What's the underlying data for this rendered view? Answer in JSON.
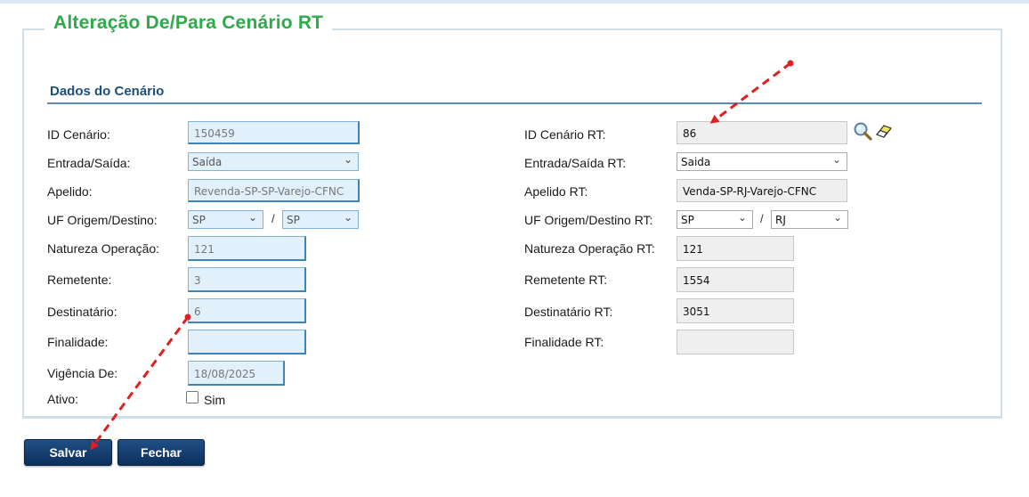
{
  "title": "Alteração De/Para Cenário RT",
  "section_title": "Dados do Cenário",
  "left": {
    "id_cenario": {
      "label": "ID Cenário:",
      "value": "150459"
    },
    "entrada_saida": {
      "label": "Entrada/Saída:",
      "value": "Saída"
    },
    "apelido": {
      "label": "Apelido:",
      "value": "Revenda-SP-SP-Varejo-CFNC"
    },
    "uf": {
      "label": "UF Origem/Destino:",
      "origem": "SP",
      "destino": "SP"
    },
    "natureza": {
      "label": "Natureza Operação:",
      "value": "121"
    },
    "remetente": {
      "label": "Remetente:",
      "value": "3"
    },
    "destinatario": {
      "label": "Destinatário:",
      "value": "6"
    },
    "finalidade": {
      "label": "Finalidade:",
      "value": ""
    },
    "vigencia": {
      "label": "Vigência De:",
      "value": "18/08/2025"
    },
    "ativo": {
      "label": "Ativo:",
      "checkbox_label": "Sim",
      "checked": false
    }
  },
  "right": {
    "id_cenario_rt": {
      "label": "ID Cenário RT:",
      "value": "86"
    },
    "entrada_saida_rt": {
      "label": "Entrada/Saída RT:",
      "value": "Saida"
    },
    "apelido_rt": {
      "label": "Apelido RT:",
      "value": "Venda-SP-RJ-Varejo-CFNC"
    },
    "uf_rt": {
      "label": "UF Origem/Destino RT:",
      "origem": "SP",
      "destino": "RJ"
    },
    "natureza_rt": {
      "label": "Natureza Operação RT:",
      "value": "121"
    },
    "remetente_rt": {
      "label": "Remetente RT:",
      "value": "1554"
    },
    "destinatario_rt": {
      "label": "Destinatário RT:",
      "value": "3051"
    },
    "finalidade_rt": {
      "label": "Finalidade RT:",
      "value": ""
    }
  },
  "uf_separator": "/",
  "buttons": {
    "save": "Salvar",
    "close": "Fechar"
  },
  "icons": {
    "search": "magnifier-icon",
    "clear": "eraser-icon"
  },
  "colors": {
    "title": "#2eaa4a",
    "section": "#1d4f7a",
    "button": "#133d6e",
    "annotation_arrow": "#e02020"
  }
}
